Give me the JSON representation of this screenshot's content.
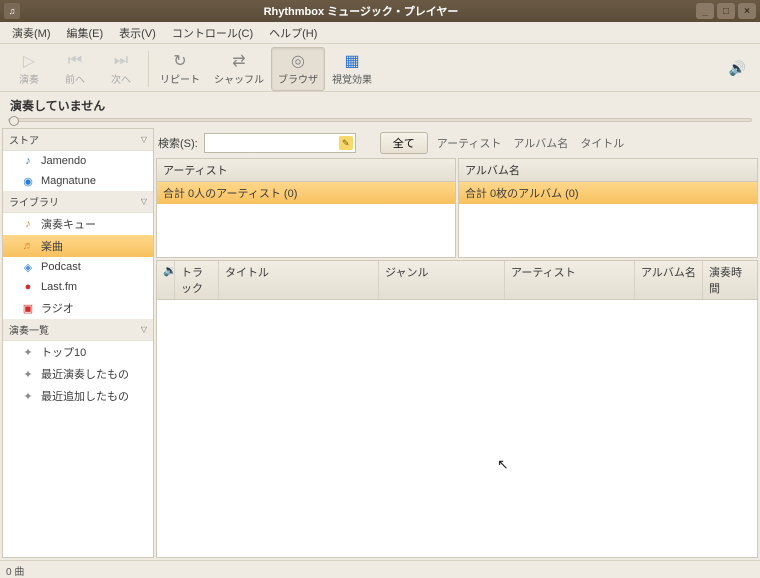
{
  "window": {
    "title": "Rhythmbox ミュージック・プレイヤー"
  },
  "menus": {
    "music": "演奏(M)",
    "edit": "編集(E)",
    "view": "表示(V)",
    "control": "コントロール(C)",
    "help": "ヘルプ(H)"
  },
  "toolbar": {
    "play": "演奏",
    "prev": "前へ",
    "next": "次へ",
    "repeat": "リピート",
    "shuffle": "シャッフル",
    "browser": "ブラウザ",
    "visual": "視覚効果"
  },
  "nowplaying": "演奏していません",
  "sidebar": {
    "groups": [
      {
        "label": "ストア",
        "items": [
          {
            "label": "Jamendo",
            "iconColor": "#2a7fd4",
            "glyph": "♪"
          },
          {
            "label": "Magnatune",
            "iconColor": "#2a7fd4",
            "glyph": "◉"
          }
        ]
      },
      {
        "label": "ライブラリ",
        "items": [
          {
            "label": "演奏キュー",
            "iconColor": "#e08a2a",
            "glyph": "♪"
          },
          {
            "label": "楽曲",
            "iconColor": "#e08a2a",
            "glyph": "♬",
            "selected": true
          },
          {
            "label": "Podcast",
            "iconColor": "#4a8fd8",
            "glyph": "◈"
          },
          {
            "label": "Last.fm",
            "iconColor": "#d02d2d",
            "glyph": "●"
          },
          {
            "label": "ラジオ",
            "iconColor": "#d02d2d",
            "glyph": "▣"
          }
        ]
      },
      {
        "label": "演奏一覧",
        "items": [
          {
            "label": "トップ10",
            "iconColor": "#888",
            "glyph": "✦"
          },
          {
            "label": "最近演奏したもの",
            "iconColor": "#888",
            "glyph": "✦"
          },
          {
            "label": "最近追加したもの",
            "iconColor": "#888",
            "glyph": "✦"
          }
        ]
      }
    ]
  },
  "search": {
    "label": "検索(S):",
    "value": "",
    "all": "全て",
    "filters": {
      "artist": "アーティスト",
      "album": "アルバム名",
      "title": "タイトル"
    }
  },
  "browser": {
    "artist_header": "アーティスト",
    "artist_total": "合計 0人のアーティスト (0)",
    "album_header": "アルバム名",
    "album_total": "合計 0枚のアルバム (0)"
  },
  "tracks": {
    "cols": {
      "track": "トラック",
      "title": "タイトル",
      "genre": "ジャンル",
      "artist": "アーティスト",
      "album": "アルバム名",
      "time": "演奏時間"
    }
  },
  "statusbar": "0 曲"
}
